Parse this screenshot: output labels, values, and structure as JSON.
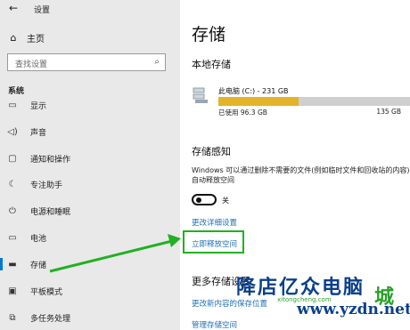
{
  "window": {
    "back_glyph": "←",
    "title": "设置"
  },
  "sidebar": {
    "home_label": "主页",
    "search_placeholder": "查找设置",
    "section_label": "系统",
    "items": [
      {
        "label": "显示",
        "icon": "monitor-icon",
        "glyph": "▭",
        "selected": false
      },
      {
        "label": "声音",
        "icon": "sound-icon",
        "glyph": "◁)",
        "selected": false
      },
      {
        "label": "通知和操作",
        "icon": "notification-icon",
        "glyph": "▢",
        "selected": false
      },
      {
        "label": "专注助手",
        "icon": "moon-icon",
        "glyph": "☾",
        "selected": false
      },
      {
        "label": "电源和睡眠",
        "icon": "power-icon",
        "glyph": "⏻",
        "selected": false
      },
      {
        "label": "电池",
        "icon": "battery-icon",
        "glyph": "▭",
        "selected": false
      },
      {
        "label": "存储",
        "icon": "storage-icon",
        "glyph": "▬",
        "selected": true
      },
      {
        "label": "平板模式",
        "icon": "tablet-icon",
        "glyph": "▣",
        "selected": false
      },
      {
        "label": "多任务处理",
        "icon": "multitask-icon",
        "glyph": "⧉",
        "selected": false
      }
    ]
  },
  "main": {
    "title": "存储",
    "local_storage_heading": "本地存储",
    "drive": {
      "name": "此电脑 (C:) - 231 GB",
      "used": "已使用 96.3 GB",
      "free": "135 GB",
      "used_fraction": 0.417
    },
    "storage_sense_heading": "存储感知",
    "storage_sense_desc": "Windows 可以通过删除不需要的文件(例如临时文件和回收站的内容)自动释放空间",
    "toggle_label": "关",
    "toggle_on": false,
    "change_settings_link": "更改详细设置",
    "free_space_link": "立即释放空间",
    "more_settings_heading": "更多存储设置",
    "change_save_location_link": "更改新内容的保存位置",
    "manage_spaces_link": "管理存储空间"
  },
  "watermark": {
    "line1": "降店亿众电脑",
    "line2": "www.yzdn.net",
    "line3": "xitongcheng.com",
    "logo": "城"
  },
  "colors": {
    "accent": "#0078d7",
    "usage_fill": "#e3b32a",
    "highlight": "#21b021",
    "link": "#1f6fb7"
  }
}
